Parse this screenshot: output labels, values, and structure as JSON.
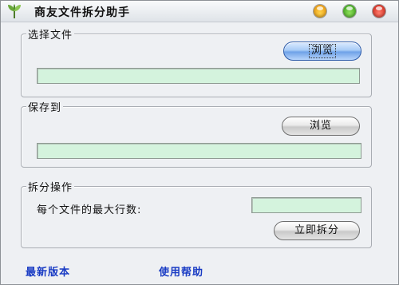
{
  "window": {
    "title": "商友文件拆分助手",
    "icons": {
      "app": "leaf-logo-icon",
      "minimize": "minimize-icon",
      "maximize": "maximize-icon",
      "close": "close-icon"
    },
    "colors": {
      "field_bg": "#d4f3dd",
      "link": "#1a3cc4"
    }
  },
  "select_file": {
    "title": "选择文件",
    "browse_label": "浏览",
    "path_value": ""
  },
  "save_to": {
    "title": "保存到",
    "browse_label": "浏览",
    "path_value": ""
  },
  "split": {
    "title": "拆分操作",
    "max_rows_label": "每个文件的最大行数:",
    "max_rows_value": "",
    "split_button_label": "立即拆分"
  },
  "footer": {
    "latest_version_link": "最新版本",
    "help_link": "使用帮助"
  }
}
